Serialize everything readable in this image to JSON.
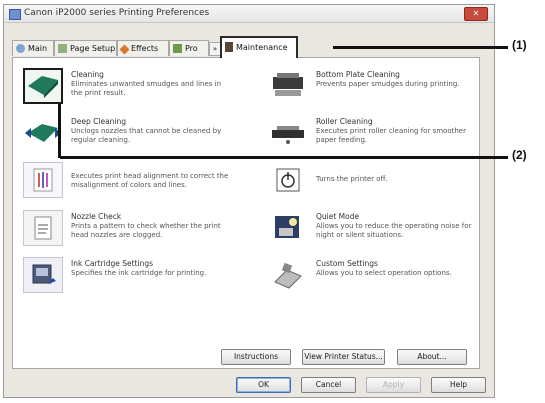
{
  "window": {
    "title": "Canon iP2000 series Printing Preferences",
    "close_label": "✕"
  },
  "tabs": [
    {
      "label": "Main",
      "icon": "main-tab-icon"
    },
    {
      "label": "Page Setup",
      "icon": "page-setup-icon"
    },
    {
      "label": "Effects",
      "icon": "effects-icon"
    },
    {
      "label": "Pro",
      "icon": "profiles-icon"
    },
    {
      "label": "Maintenance",
      "icon": "maintenance-icon",
      "active": true
    }
  ],
  "tab_scroll_label": "»",
  "items": [
    {
      "title": "Cleaning",
      "desc": "Eliminates unwanted smudges and lines in the print result.",
      "icon": "cleaning-icon",
      "selected": true
    },
    {
      "title": "Deep Cleaning",
      "desc": "Unclogs nozzles that cannot be cleaned by regular cleaning.",
      "icon": "deep-cleaning-icon"
    },
    {
      "title": "",
      "desc": "Executes print head alignment to correct the misalignment of colors and lines.",
      "icon": "alignment-icon"
    },
    {
      "title": "Nozzle Check",
      "desc": "Prints a pattern to check whether the print head nozzles are clogged.",
      "icon": "nozzle-check-icon"
    },
    {
      "title": "Ink Cartridge Settings",
      "desc": "Specifies the ink cartridge for printing.",
      "icon": "ink-cartridge-icon"
    },
    {
      "title": "Bottom Plate Cleaning",
      "desc": "Prevents paper smudges during printing.",
      "icon": "bottom-plate-icon"
    },
    {
      "title": "Roller Cleaning",
      "desc": "Executes print roller cleaning for smoother paper feeding.",
      "icon": "roller-cleaning-icon"
    },
    {
      "title": "",
      "desc": "Turns the printer off.",
      "icon": "power-off-icon"
    },
    {
      "title": "Quiet Mode",
      "desc": "Allows you to reduce the operating noise for night or silent situations.",
      "icon": "quiet-mode-icon"
    },
    {
      "title": "Custom Settings",
      "desc": "Allows you to select operation options.",
      "icon": "custom-settings-icon"
    }
  ],
  "panel_buttons": {
    "instructions": "Instructions",
    "status": "View Printer Status...",
    "about": "About..."
  },
  "dialog_buttons": {
    "ok": "OK",
    "cancel": "Cancel",
    "apply": "Apply",
    "help": "Help"
  },
  "callouts": {
    "one": "(1)",
    "two": "(2)"
  }
}
